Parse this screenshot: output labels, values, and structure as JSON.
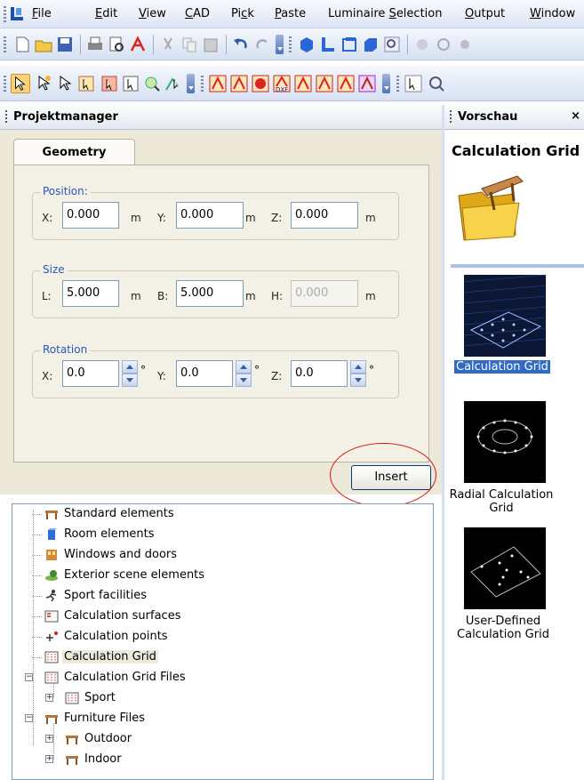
{
  "menu": {
    "items": [
      {
        "pre": "",
        "ul": "F",
        "post": "ile"
      },
      {
        "pre": "",
        "ul": "E",
        "post": "dit"
      },
      {
        "pre": "",
        "ul": "V",
        "post": "iew"
      },
      {
        "pre": "",
        "ul": "C",
        "post": "AD"
      },
      {
        "pre": "Pi",
        "ul": "c",
        "post": "k"
      },
      {
        "pre": "",
        "ul": "P",
        "post": "aste"
      },
      {
        "pre": "Luminaire ",
        "ul": "S",
        "post": "election"
      },
      {
        "pre": "",
        "ul": "O",
        "post": "utput"
      },
      {
        "pre": "",
        "ul": "W",
        "post": "indow"
      }
    ]
  },
  "panels": {
    "left_title": "Projektmanager",
    "right_title": "Vorschau",
    "close_glyph": "×"
  },
  "form": {
    "tab_label": "Geometry",
    "position": {
      "label": "Position:",
      "x_label": "X:",
      "x_value": "0.000",
      "y_label": "Y:",
      "y_value": "0.000",
      "z_label": "Z:",
      "z_value": "0.000",
      "unit": "m"
    },
    "size": {
      "label": "Size",
      "l_label": "L:",
      "l_value": "5.000",
      "b_label": "B:",
      "b_value": "5.000",
      "h_label": "H:",
      "h_value": "0.000",
      "unit": "m"
    },
    "rotation": {
      "label": "Rotation",
      "x_label": "X:",
      "x_value": "0.0",
      "y_label": "Y:",
      "y_value": "0.0",
      "z_label": "Z:",
      "z_value": "0.0",
      "unit": "°"
    },
    "insert_label": "Insert"
  },
  "tree": {
    "items": [
      {
        "label": "Standard elements"
      },
      {
        "label": "Room elements"
      },
      {
        "label": "Windows and doors"
      },
      {
        "label": "Exterior scene elements"
      },
      {
        "label": "Sport facilities"
      },
      {
        "label": "Calculation surfaces"
      },
      {
        "label": "Calculation points"
      },
      {
        "label": "Calculation Grid"
      },
      {
        "label": "Calculation Grid Files"
      },
      {
        "label": "Sport"
      },
      {
        "label": "Furniture Files"
      },
      {
        "label": "Outdoor"
      },
      {
        "label": "Indoor"
      }
    ],
    "expander_plus": "+",
    "expander_minus": "−"
  },
  "preview": {
    "title": "Calculation Grid",
    "thumbs": [
      {
        "label": "Calculation Grid"
      },
      {
        "label": "Radial Calculation Grid"
      },
      {
        "label": "User-Defined Calculation Grid"
      }
    ]
  },
  "colors": {
    "accent_blue": "#316ac5",
    "highlight_red": "#dd1111",
    "panel_beige": "#ece9d8",
    "group_label_blue": "#2855b8"
  }
}
